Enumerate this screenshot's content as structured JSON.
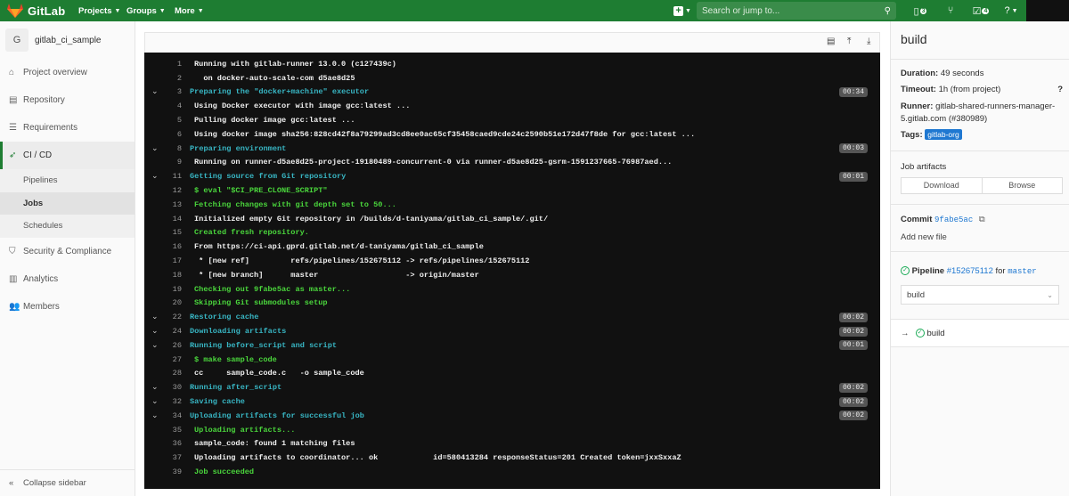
{
  "topbar": {
    "brand": "GitLab",
    "menus": [
      {
        "label": "Projects"
      },
      {
        "label": "Groups"
      },
      {
        "label": "More"
      }
    ],
    "search_placeholder": "Search or jump to...",
    "issues_count": "3",
    "todos_count": "4"
  },
  "sidebar": {
    "project_initial": "G",
    "project_name": "gitlab_ci_sample",
    "items": [
      {
        "label": "Project overview"
      },
      {
        "label": "Repository"
      },
      {
        "label": "Requirements"
      },
      {
        "label": "CI / CD"
      },
      {
        "label": "Security & Compliance"
      },
      {
        "label": "Analytics"
      },
      {
        "label": "Members"
      }
    ],
    "cicd_sub": [
      {
        "label": "Pipelines"
      },
      {
        "label": "Jobs"
      },
      {
        "label": "Schedules"
      }
    ],
    "collapse_label": "Collapse sidebar"
  },
  "log": {
    "lines": [
      {
        "n": "1",
        "t": "Running with gitlab-runner 13.0.0 (c127439c)",
        "c": "white",
        "sec": false
      },
      {
        "n": "2",
        "t": "  on docker-auto-scale-com d5ae8d25",
        "c": "white",
        "sec": false
      },
      {
        "n": "3",
        "t": "Preparing the \"docker+machine\" executor",
        "c": "cyan",
        "sec": true,
        "d": "00:34"
      },
      {
        "n": "4",
        "t": "Using Docker executor with image gcc:latest ...",
        "c": "white",
        "sec": false
      },
      {
        "n": "5",
        "t": "Pulling docker image gcc:latest ...",
        "c": "white",
        "sec": false
      },
      {
        "n": "6",
        "t": "Using docker image sha256:828cd42f8a79299ad3cd8ee0ac65cf35458caed9cde24c2590b51e172d47f8de for gcc:latest ...",
        "c": "white",
        "sec": false
      },
      {
        "n": "8",
        "t": "Preparing environment",
        "c": "cyan",
        "sec": true,
        "d": "00:03"
      },
      {
        "n": "9",
        "t": "Running on runner-d5ae8d25-project-19180489-concurrent-0 via runner-d5ae8d25-gsrm-1591237665-76987aed...",
        "c": "white",
        "sec": false
      },
      {
        "n": "11",
        "t": "Getting source from Git repository",
        "c": "cyan",
        "sec": true,
        "d": "00:01"
      },
      {
        "n": "12",
        "t": "$ eval \"$CI_PRE_CLONE_SCRIPT\"",
        "c": "green",
        "sec": false
      },
      {
        "n": "13",
        "t": "Fetching changes with git depth set to 50...",
        "c": "green",
        "sec": false
      },
      {
        "n": "14",
        "t": "Initialized empty Git repository in /builds/d-taniyama/gitlab_ci_sample/.git/",
        "c": "white",
        "sec": false
      },
      {
        "n": "15",
        "t": "Created fresh repository.",
        "c": "green",
        "sec": false
      },
      {
        "n": "16",
        "t": "From https://ci-api.gprd.gitlab.net/d-taniyama/gitlab_ci_sample",
        "c": "white",
        "sec": false
      },
      {
        "n": "17",
        "t": " * [new ref]         refs/pipelines/152675112 -> refs/pipelines/152675112",
        "c": "white",
        "sec": false
      },
      {
        "n": "18",
        "t": " * [new branch]      master                   -> origin/master",
        "c": "white",
        "sec": false
      },
      {
        "n": "19",
        "t": "Checking out 9fabe5ac as master...",
        "c": "green",
        "sec": false
      },
      {
        "n": "20",
        "t": "Skipping Git submodules setup",
        "c": "green",
        "sec": false
      },
      {
        "n": "22",
        "t": "Restoring cache",
        "c": "cyan",
        "sec": true,
        "d": "00:02"
      },
      {
        "n": "24",
        "t": "Downloading artifacts",
        "c": "cyan",
        "sec": true,
        "d": "00:02"
      },
      {
        "n": "26",
        "t": "Running before_script and script",
        "c": "cyan",
        "sec": true,
        "d": "00:01"
      },
      {
        "n": "27",
        "t": "$ make sample_code",
        "c": "green",
        "sec": false
      },
      {
        "n": "28",
        "t": "cc     sample_code.c   -o sample_code",
        "c": "white",
        "sec": false
      },
      {
        "n": "30",
        "t": "Running after_script",
        "c": "cyan",
        "sec": true,
        "d": "00:02"
      },
      {
        "n": "32",
        "t": "Saving cache",
        "c": "cyan",
        "sec": true,
        "d": "00:02"
      },
      {
        "n": "34",
        "t": "Uploading artifacts for successful job",
        "c": "cyan",
        "sec": true,
        "d": "00:02"
      },
      {
        "n": "35",
        "t": "Uploading artifacts...",
        "c": "green",
        "sec": false
      },
      {
        "n": "36",
        "t": "sample_code: found 1 matching files",
        "c": "white",
        "sec": false
      },
      {
        "n": "37",
        "t": "Uploading artifacts to coordinator... ok            id=580413284 responseStatus=201 Created token=jxxSxxaZ",
        "c": "white",
        "sec": false
      },
      {
        "n": "39",
        "t": "Job succeeded",
        "c": "green",
        "sec": false
      }
    ]
  },
  "right": {
    "title": "build",
    "duration_label": "Duration:",
    "duration_value": "49 seconds",
    "timeout_label": "Timeout:",
    "timeout_value": "1h (from project)",
    "runner_label": "Runner:",
    "runner_value": "gitlab-shared-runners-manager-5.gitlab.com (#380989)",
    "tags_label": "Tags:",
    "tag": "gitlab-org",
    "artifacts_title": "Job artifacts",
    "download_label": "Download",
    "browse_label": "Browse",
    "commit_label": "Commit",
    "commit_sha": "9fabe5ac",
    "commit_title": "Add new file",
    "pipeline_label": "Pipeline",
    "pipeline_id": "#152675112",
    "pipeline_for": "for",
    "pipeline_branch": "master",
    "stage_select": "build",
    "current_job": "build"
  }
}
